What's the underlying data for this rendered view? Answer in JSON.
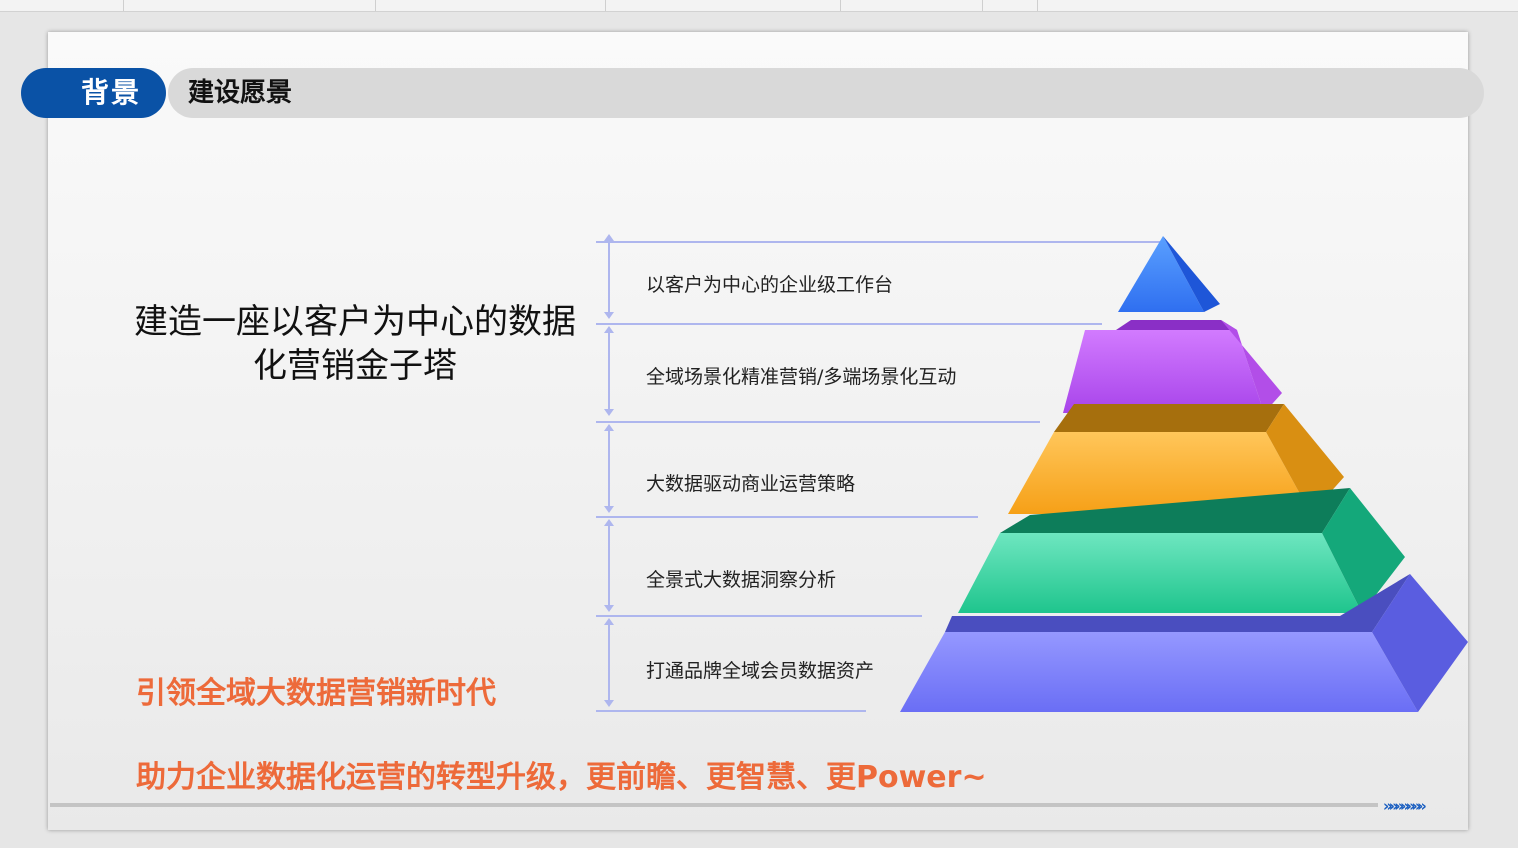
{
  "header": {
    "pill_label": "背景",
    "title": "建设愿景"
  },
  "main_title": "建造一座以客户为中心的数据化营销金子塔",
  "pyramid": {
    "tiers": [
      {
        "label": "以客户为中心的企业级工作台",
        "color": "#3f86ff"
      },
      {
        "label": "全域场景化精准营销/多端场景化互动",
        "color": "#c25af0"
      },
      {
        "label": "大数据驱动商业运营策略",
        "color": "#fbac21"
      },
      {
        "label": "全景式大数据洞察分析",
        "color": "#2fd39a"
      },
      {
        "label": "打通品牌全域会员数据资产",
        "color": "#7a7ef8"
      }
    ]
  },
  "slogans": {
    "line1": "引领全域大数据营销新时代",
    "line2": "助力企业数据化运营的转型升级，更前瞻、更智慧、更Power~"
  },
  "footer": {
    "chevrons": "»»»»»»»"
  },
  "colors": {
    "accent_blue": "#0a52a6",
    "slogan_orange": "#ed6a3a",
    "guide_line": "#aeb6ee"
  }
}
